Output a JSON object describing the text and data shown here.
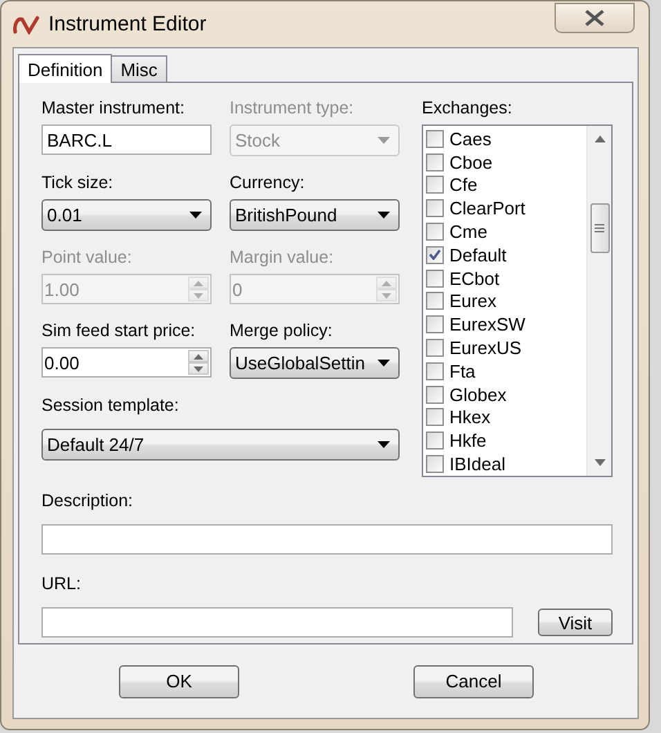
{
  "window": {
    "title": "Instrument Editor"
  },
  "tabs": [
    {
      "label": "Definition",
      "selected": true
    },
    {
      "label": "Misc",
      "selected": false
    }
  ],
  "fields": [
    {
      "label": "Master instrument:",
      "kind": "text",
      "value": "BARC.L",
      "disabled": false
    },
    {
      "label": "Instrument type:",
      "kind": "dropdown",
      "value": "Stock",
      "disabled": true
    },
    {
      "label": "Tick size:",
      "kind": "dropdown",
      "value": "0.01",
      "disabled": false
    },
    {
      "label": "Currency:",
      "kind": "dropdown",
      "value": "BritishPound",
      "disabled": false
    },
    {
      "label": "Point value:",
      "kind": "spin",
      "value": "1.00",
      "disabled": true
    },
    {
      "label": "Margin value:",
      "kind": "spin",
      "value": "0",
      "disabled": true
    },
    {
      "label": "Sim feed start price:",
      "kind": "spin",
      "value": "0.00",
      "disabled": false
    },
    {
      "label": "Merge policy:",
      "kind": "dropdown",
      "value": "UseGlobalSettin",
      "disabled": false
    }
  ],
  "session_template": {
    "label": "Session template:",
    "value": "Default 24/7"
  },
  "exchanges": {
    "label": "Exchanges:",
    "items": [
      {
        "name": "Caes",
        "checked": false
      },
      {
        "name": "Cboe",
        "checked": false
      },
      {
        "name": "Cfe",
        "checked": false
      },
      {
        "name": "ClearPort",
        "checked": false
      },
      {
        "name": "Cme",
        "checked": false
      },
      {
        "name": "Default",
        "checked": true
      },
      {
        "name": "ECbot",
        "checked": false
      },
      {
        "name": "Eurex",
        "checked": false
      },
      {
        "name": "EurexSW",
        "checked": false
      },
      {
        "name": "EurexUS",
        "checked": false
      },
      {
        "name": "Fta",
        "checked": false
      },
      {
        "name": "Globex",
        "checked": false
      },
      {
        "name": "Hkex",
        "checked": false
      },
      {
        "name": "Hkfe",
        "checked": false
      },
      {
        "name": "IBIdeal",
        "checked": false
      }
    ]
  },
  "description": {
    "label": "Description:"
  },
  "url": {
    "label": "URL:",
    "button": "Visit"
  },
  "buttons": [
    "OK",
    "Cancel"
  ]
}
